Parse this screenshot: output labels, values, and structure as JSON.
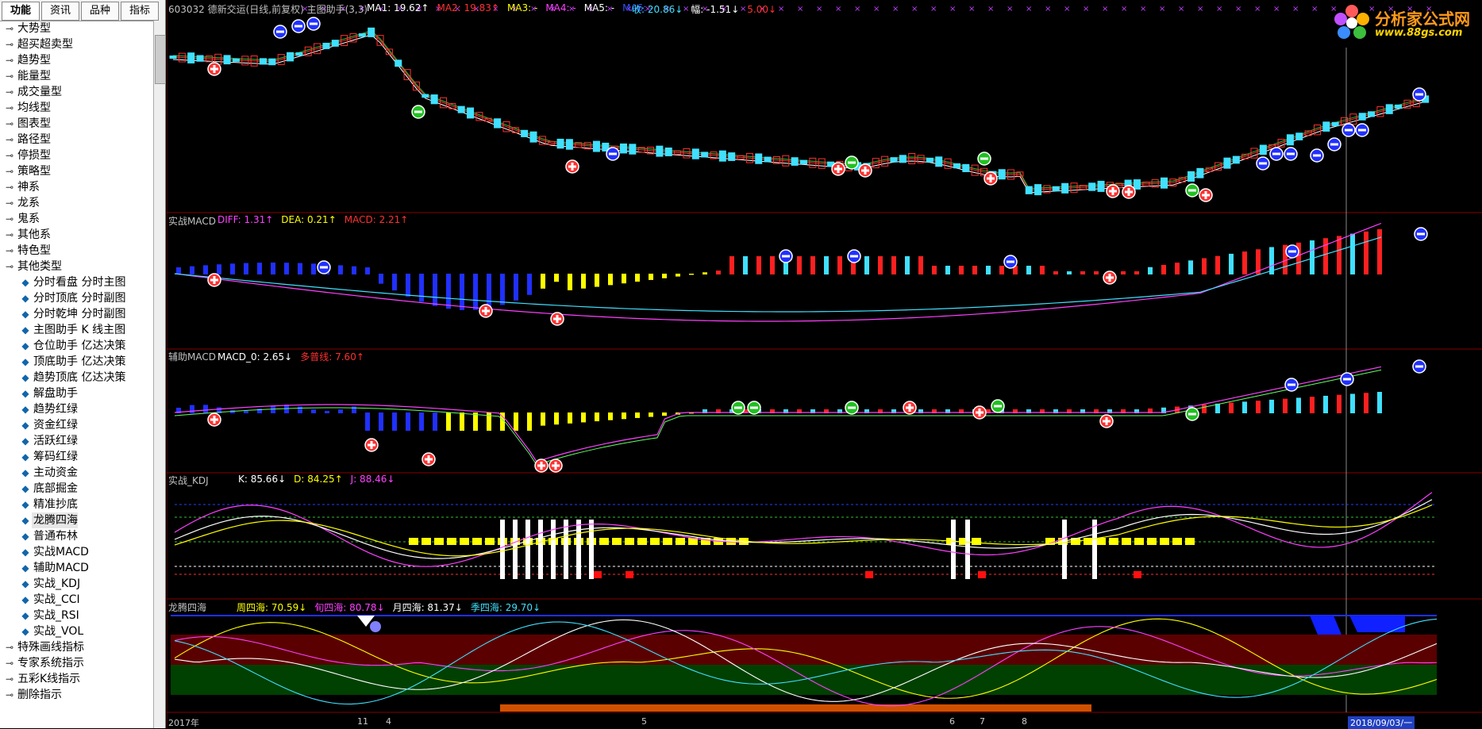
{
  "sidebar": {
    "tabs": [
      "功能",
      "资讯",
      "品种",
      "指标"
    ],
    "tree": [
      {
        "label": "大势型",
        "level": 0
      },
      {
        "label": "超买超卖型",
        "level": 0
      },
      {
        "label": "趋势型",
        "level": 0
      },
      {
        "label": "能量型",
        "level": 0
      },
      {
        "label": "成交量型",
        "level": 0
      },
      {
        "label": "均线型",
        "level": 0
      },
      {
        "label": "图表型",
        "level": 0
      },
      {
        "label": "路径型",
        "level": 0
      },
      {
        "label": "停损型",
        "level": 0
      },
      {
        "label": "策略型",
        "level": 0
      },
      {
        "label": "神系",
        "level": 0
      },
      {
        "label": "龙系",
        "level": 0
      },
      {
        "label": "鬼系",
        "level": 0
      },
      {
        "label": "其他系",
        "level": 0
      },
      {
        "label": "特色型",
        "level": 0
      },
      {
        "label": "其他类型",
        "level": 0
      },
      {
        "label": "分时看盘 分时主图",
        "level": 1
      },
      {
        "label": "分时顶底 分时副图",
        "level": 1
      },
      {
        "label": "分时乾坤 分时副图",
        "level": 1
      },
      {
        "label": "主图助手 K 线主图",
        "level": 1
      },
      {
        "label": "仓位助手 亿达决策",
        "level": 1
      },
      {
        "label": "顶底助手 亿达决策",
        "level": 1
      },
      {
        "label": "趋势顶底 亿达决策",
        "level": 1
      },
      {
        "label": "解盘助手",
        "level": 1
      },
      {
        "label": "趋势红绿",
        "level": 1
      },
      {
        "label": "资金红绿",
        "level": 1
      },
      {
        "label": "活跃红绿",
        "level": 1
      },
      {
        "label": "筹码红绿",
        "level": 1
      },
      {
        "label": "主动资金",
        "level": 1
      },
      {
        "label": "底部掘金",
        "level": 1
      },
      {
        "label": "精准抄底",
        "level": 1
      },
      {
        "label": "龙腾四海",
        "level": 1
      },
      {
        "label": "普通布林",
        "level": 1
      },
      {
        "label": "实战MACD",
        "level": 1
      },
      {
        "label": "辅助MACD",
        "level": 1
      },
      {
        "label": "实战_KDJ",
        "level": 1
      },
      {
        "label": "实战_CCI",
        "level": 1
      },
      {
        "label": "实战_RSI",
        "level": 1
      },
      {
        "label": "实战_VOL",
        "level": 1
      },
      {
        "label": "特殊画线指标",
        "level": 0
      },
      {
        "label": "专家系统指示",
        "level": 0
      },
      {
        "label": "五彩K线指示",
        "level": 0
      },
      {
        "label": "删除指示",
        "level": 0
      }
    ]
  },
  "main_header": {
    "stock": "603032 德新交运(日线,前复权) 主图助手(3,3)",
    "ma": [
      {
        "label": "MA1: 19.62↑",
        "color": "#ffffff"
      },
      {
        "label": "MA2: 19.83↑",
        "color": "#ff3030"
      },
      {
        "label": "MA3: -",
        "color": "#ffff00"
      },
      {
        "label": "MA4: -",
        "color": "#ff40ff"
      },
      {
        "label": "MA5: -",
        "color": "#ffffff"
      },
      {
        "label": "MA6: -",
        "color": "#3050ff"
      }
    ],
    "extra": [
      {
        "label": "收: 20.86↓",
        "color": "#40e0ff"
      },
      {
        "label": "幅: -1.51↓",
        "color": "#ffffff"
      },
      {
        "label": "5.00↓",
        "color": "#ff3030"
      }
    ]
  },
  "panels": {
    "macd": {
      "title": "实战MACD",
      "items": [
        {
          "label": "DIFF: 1.31↑",
          "color": "#ff40ff"
        },
        {
          "label": "DEA: 0.21↑",
          "color": "#ffff00"
        },
        {
          "label": "MACD: 2.21↑",
          "color": "#ff3030"
        }
      ]
    },
    "aux": {
      "title": "辅助MACD",
      "items": [
        {
          "label": "MACD_0: 2.65↓",
          "color": "#ffffff"
        },
        {
          "label": "多普线: 7.60↑",
          "color": "#ff3030"
        }
      ]
    },
    "kdj": {
      "title": "实战_KDJ",
      "items": [
        {
          "label": "K: 85.66↓",
          "color": "#ffffff"
        },
        {
          "label": "D: 84.25↑",
          "color": "#ffff00"
        },
        {
          "label": "J: 88.46↓",
          "color": "#ff40ff"
        }
      ]
    },
    "lt": {
      "title": "龙腾四海",
      "items": [
        {
          "label": "周四海: 70.59↓",
          "color": "#ffff00"
        },
        {
          "label": "旬四海: 80.78↓",
          "color": "#ff40ff"
        },
        {
          "label": "月四海: 81.37↓",
          "color": "#ffffff"
        },
        {
          "label": "季四海: 29.70↓",
          "color": "#40e0ff"
        }
      ]
    }
  },
  "axis": {
    "dates": [
      "2017年",
      "11",
      "4",
      "5",
      "6",
      "7",
      "8"
    ],
    "cursor_date": "2018/09/03/一"
  },
  "logo": {
    "line1": "分析家公式网",
    "line2": "www.88gs.com"
  },
  "colors": {
    "up": "#ff3030",
    "down": "#40e0ff",
    "background": "#000000",
    "frame": "#a00000"
  }
}
